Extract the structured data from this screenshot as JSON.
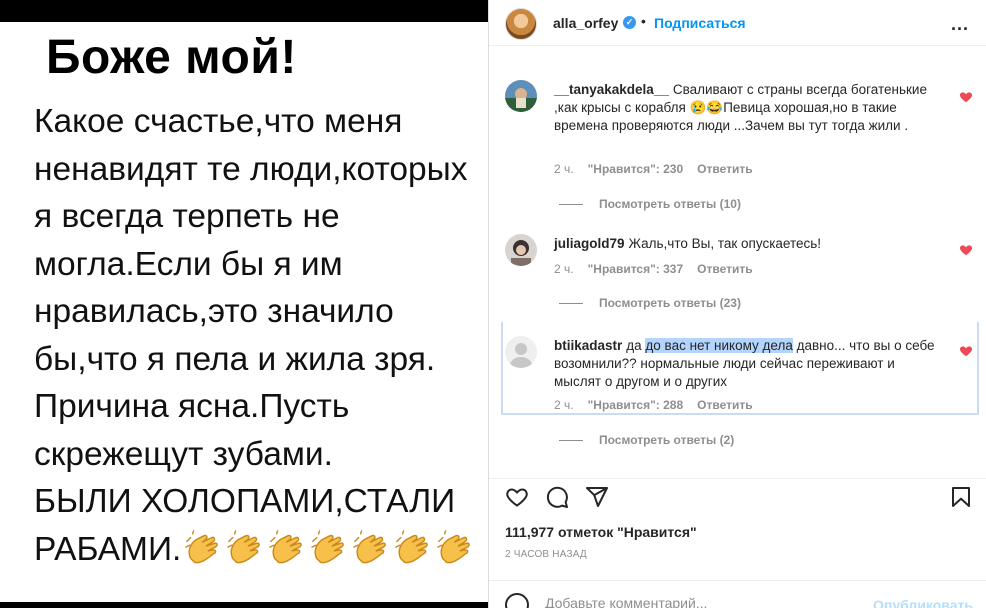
{
  "post_image": {
    "headline": "Боже мой!",
    "body": "Какое счастье,что меня\nненавидят те люди,которых\nя всегда терпеть не\nмогла.Если бы я им\nнравилась,это значило\nбы,что я пела и жила зря.\nПричина ясна.Пусть\nскрежещут зубами.\nБЫЛИ ХОЛОПАМИ,СТАЛИ\nРАБАМИ.",
    "emoji": "clapping-hands",
    "emoji_count": 7
  },
  "header": {
    "username": "alla_orfey",
    "verified_icon": "verified-badge-icon",
    "separator": "•",
    "follow_label": "Подписаться",
    "more_label": "..."
  },
  "comments": [
    {
      "user": "__tanyakakdela__",
      "text": "Сваливают с страны всегда богатенькие ,как крысы с корабля 😢😂Певица хорошая,но в такие времена проверяются люди ...Зачем вы тут тогда жили .",
      "time": "2 ч.",
      "likes": "\"Нравится\": 230",
      "reply": "Ответить",
      "view_replies": "Посмотреть ответы (10)",
      "liked": true
    },
    {
      "user": "juliagold79",
      "text": "Жаль,что Вы, так опускаетесь!",
      "time": "2 ч.",
      "likes": "\"Нравится\": 337",
      "reply": "Ответить",
      "view_replies": "Посмотреть ответы (23)",
      "liked": true
    },
    {
      "user": "btiikadastr",
      "text_before": "да ",
      "text_selected": "до вас нет никому дела",
      "text_after": " давно... что вы о себе возомнили?? нормальные люди сейчас переживают и мыслят о другом и о других",
      "time": "2 ч.",
      "likes": "\"Нравится\": 288",
      "reply": "Ответить",
      "view_replies": "Посмотреть ответы (2)",
      "liked": true
    }
  ],
  "footer": {
    "likes_count": "111,977 отметок \"Нравится\"",
    "time_ago": "2 ЧАСОВ НАЗАД",
    "comment_placeholder": "Добавьте комментарий...",
    "publish_label": "Опубликовать"
  },
  "colors": {
    "accent": "#0095f6",
    "heart": "#ed4956",
    "muted": "#8e8e8e",
    "selection": "#b3d4fc"
  }
}
